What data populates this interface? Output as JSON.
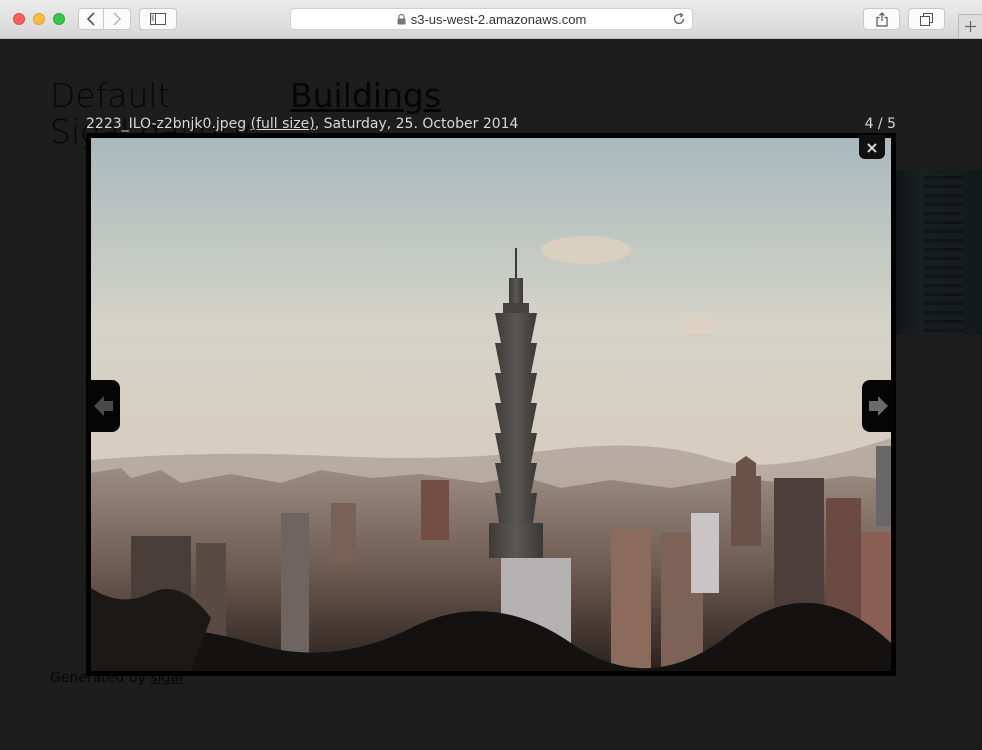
{
  "browser": {
    "url": "s3-us-west-2.amazonaws.com",
    "icons": [
      "back-icon",
      "forward-icon",
      "sidebar-icon",
      "lock-icon",
      "reload-icon",
      "share-icon",
      "tabs-icon",
      "plus-icon"
    ]
  },
  "page": {
    "site_title": "Default Sigal gallery",
    "breadcrumb": "Buildings",
    "footer_prefix": "Generated by ",
    "footer_link": "sigal"
  },
  "lightbox": {
    "filename": "2223_ILO-z2bnjk0.jpeg",
    "full_size_link": "(full size)",
    "date": ", Saturday, 25. October 2014",
    "counter": "4 / 5",
    "close_label": "×",
    "photo_subject": "Taipei 101 tower over city skyline"
  }
}
